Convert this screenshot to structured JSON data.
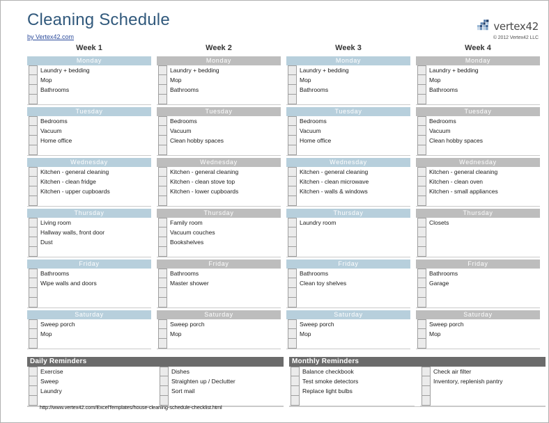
{
  "document": {
    "title": "Cleaning Schedule",
    "byline": "by Vertex42.com",
    "footer_url": "http://www.vertex42.com/ExcelTemplates/house-cleaning-schedule-checklist.html"
  },
  "brand": {
    "name": "vertex42",
    "copyright": "© 2012 Vertex42 LLC",
    "logo_icon": "vertex42-mosaic-logo",
    "accent_blue": "#31597c",
    "day_header_blue": "#b7cfdc",
    "day_header_gray": "#bdbdbd",
    "reminder_header_gray": "#6b6b6b"
  },
  "weeks": [
    {
      "label": "Week 1",
      "accent": "blue",
      "days": [
        {
          "name": "Monday",
          "rows": 4,
          "tasks": [
            "Laundry + bedding",
            "Mop",
            "Bathrooms"
          ]
        },
        {
          "name": "Tuesday",
          "rows": 4,
          "tasks": [
            "Bedrooms",
            "Vacuum",
            "Home office"
          ]
        },
        {
          "name": "Wednesday",
          "rows": 4,
          "tasks": [
            "Kitchen - general cleaning",
            "Kitchen - clean fridge",
            "Kitchen - upper cupboards"
          ]
        },
        {
          "name": "Thursday",
          "rows": 4,
          "tasks": [
            "Living room",
            "Hallway walls, front door",
            "Dust"
          ]
        },
        {
          "name": "Friday",
          "rows": 4,
          "tasks": [
            "Bathrooms",
            "Wipe walls and doors"
          ]
        },
        {
          "name": "Saturday",
          "rows": 3,
          "tasks": [
            "Sweep porch",
            "Mop"
          ]
        }
      ]
    },
    {
      "label": "Week 2",
      "accent": "gray",
      "days": [
        {
          "name": "Monday",
          "rows": 4,
          "tasks": [
            "Laundry + bedding",
            "Mop",
            "Bathrooms"
          ]
        },
        {
          "name": "Tuesday",
          "rows": 4,
          "tasks": [
            "Bedrooms",
            "Vacuum",
            "Clean hobby spaces"
          ]
        },
        {
          "name": "Wednesday",
          "rows": 4,
          "tasks": [
            "Kitchen - general cleaning",
            "Kitchen - clean stove top",
            "Kitchen - lower cupboards"
          ]
        },
        {
          "name": "Thursday",
          "rows": 4,
          "tasks": [
            "Family room",
            "Vacuum couches",
            "Bookshelves"
          ]
        },
        {
          "name": "Friday",
          "rows": 4,
          "tasks": [
            "Bathrooms",
            "Master shower"
          ]
        },
        {
          "name": "Saturday",
          "rows": 3,
          "tasks": [
            "Sweep porch",
            "Mop"
          ]
        }
      ]
    },
    {
      "label": "Week 3",
      "accent": "blue",
      "days": [
        {
          "name": "Monday",
          "rows": 4,
          "tasks": [
            "Laundry + bedding",
            "Mop",
            "Bathrooms"
          ]
        },
        {
          "name": "Tuesday",
          "rows": 4,
          "tasks": [
            "Bedrooms",
            "Vacuum",
            "Home office"
          ]
        },
        {
          "name": "Wednesday",
          "rows": 4,
          "tasks": [
            "Kitchen - general cleaning",
            "Kitchen - clean microwave",
            "Kitchen - walls & windows"
          ]
        },
        {
          "name": "Thursday",
          "rows": 4,
          "tasks": [
            "Laundry room"
          ]
        },
        {
          "name": "Friday",
          "rows": 4,
          "tasks": [
            "Bathrooms",
            "Clean toy shelves"
          ]
        },
        {
          "name": "Saturday",
          "rows": 3,
          "tasks": [
            "Sweep porch",
            "Mop"
          ]
        }
      ]
    },
    {
      "label": "Week 4",
      "accent": "gray",
      "days": [
        {
          "name": "Monday",
          "rows": 4,
          "tasks": [
            "Laundry + bedding",
            "Mop",
            "Bathrooms"
          ]
        },
        {
          "name": "Tuesday",
          "rows": 4,
          "tasks": [
            "Bedrooms",
            "Vacuum",
            "Clean hobby spaces"
          ]
        },
        {
          "name": "Wednesday",
          "rows": 4,
          "tasks": [
            "Kitchen - general cleaning",
            "Kitchen - clean oven",
            "Kitchen - small appliances"
          ]
        },
        {
          "name": "Thursday",
          "rows": 4,
          "tasks": [
            "Closets"
          ]
        },
        {
          "name": "Friday",
          "rows": 4,
          "tasks": [
            "Bathrooms",
            "Garage"
          ]
        },
        {
          "name": "Saturday",
          "rows": 3,
          "tasks": [
            "Sweep porch",
            "Mop"
          ]
        }
      ]
    }
  ],
  "reminders": [
    {
      "title": "Daily Reminders",
      "columns": [
        {
          "rows": 4,
          "tasks": [
            "Exercise",
            "Sweep",
            "Laundry"
          ]
        },
        {
          "rows": 4,
          "tasks": [
            "Dishes",
            "Straighten up / Declutter",
            "Sort mail"
          ]
        }
      ]
    },
    {
      "title": "Monthly Reminders",
      "columns": [
        {
          "rows": 4,
          "tasks": [
            "Balance checkbook",
            "Test smoke detectors",
            "Replace light bulbs"
          ]
        },
        {
          "rows": 4,
          "tasks": [
            "Check air filter",
            "Inventory, replenish pantry"
          ]
        }
      ]
    }
  ]
}
